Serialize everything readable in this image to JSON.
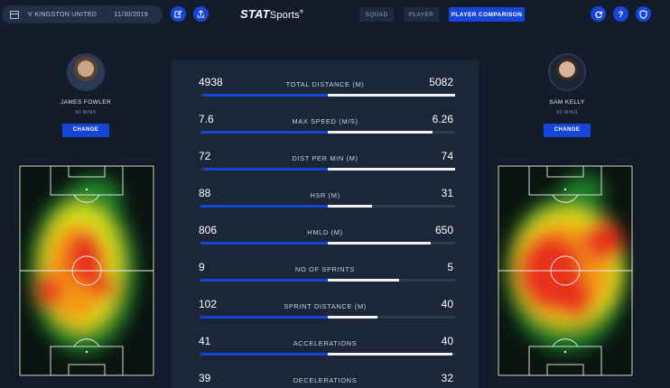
{
  "header": {
    "opponent": "V KINGSTON UNITED",
    "date": "11/30/2019",
    "logo_main": "STAT",
    "logo_sub": "Sports",
    "logo_mark": "®",
    "nav": [
      {
        "label": "SQUAD",
        "active": false
      },
      {
        "label": "PLAYER",
        "active": false
      },
      {
        "label": "PLAYER COMPARISON",
        "active": true
      }
    ],
    "edit_icon": "edit-icon",
    "share_icon": "share-icon",
    "refresh_icon": "refresh-icon",
    "help_icon": "?",
    "shield_icon": "shield-icon"
  },
  "players": {
    "left": {
      "name": "JAMES FOWLER",
      "minutes": "90 MINS",
      "change_label": "CHANGE"
    },
    "right": {
      "name": "SAM KELLY",
      "minutes": "90 MINS",
      "change_label": "CHANGE"
    }
  },
  "stats": [
    {
      "label": "TOTAL DISTANCE (M)",
      "left": "4938",
      "right": "5082",
      "left_fill": 0.98,
      "right_fill": 1.0
    },
    {
      "label": "MAX SPEED (M/S)",
      "left": "7.6",
      "right": "6.26",
      "left_fill": 1.0,
      "right_fill": 0.82
    },
    {
      "label": "DIST PER MIN (M)",
      "left": "72",
      "right": "74",
      "left_fill": 0.97,
      "right_fill": 1.0
    },
    {
      "label": "HSR (M)",
      "left": "88",
      "right": "31",
      "left_fill": 1.0,
      "right_fill": 0.35
    },
    {
      "label": "HMLD (M)",
      "left": "806",
      "right": "650",
      "left_fill": 1.0,
      "right_fill": 0.81
    },
    {
      "label": "NO OF SPRINTS",
      "left": "9",
      "right": "5",
      "left_fill": 1.0,
      "right_fill": 0.56
    },
    {
      "label": "SPRINT DISTANCE (M)",
      "left": "102",
      "right": "40",
      "left_fill": 1.0,
      "right_fill": 0.39
    },
    {
      "label": "ACCELERATIONS",
      "left": "41",
      "right": "40",
      "left_fill": 1.0,
      "right_fill": 0.98
    },
    {
      "label": "DECELERATIONS",
      "left": "39",
      "right": "32",
      "left_fill": 1.0,
      "right_fill": 0.82
    }
  ],
  "colors": {
    "accent": "#1646d8",
    "panel": "#1b2638",
    "background": "#131c2b"
  }
}
